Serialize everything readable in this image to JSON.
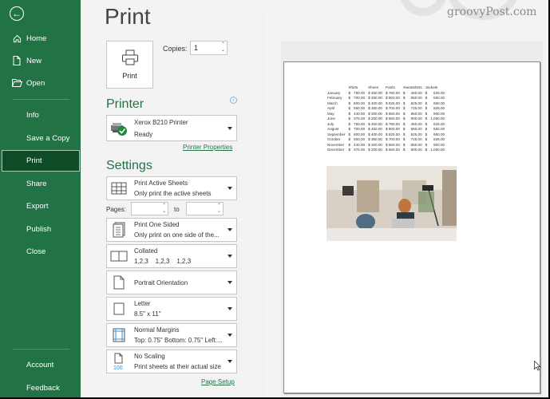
{
  "sidebar": {
    "back_icon": "arrow-left-circle-icon",
    "items": [
      {
        "label": "Home",
        "icon": "home-icon"
      },
      {
        "label": "New",
        "icon": "new-file-icon"
      },
      {
        "label": "Open",
        "icon": "folder-open-icon"
      },
      {
        "label": "Info"
      },
      {
        "label": "Save a Copy"
      },
      {
        "label": "Print",
        "active": true
      },
      {
        "label": "Share"
      },
      {
        "label": "Export"
      },
      {
        "label": "Publish"
      },
      {
        "label": "Close"
      }
    ],
    "footer": [
      {
        "label": "Account"
      },
      {
        "label": "Feedback"
      }
    ],
    "accent_color": "#217346",
    "active_color": "#0e4b26"
  },
  "main": {
    "title": "Print",
    "print_button_label": "Print",
    "copies_label": "Copies:",
    "copies_value": "1",
    "printer_heading": "Printer",
    "printer": {
      "name": "Xerox B210 Printer",
      "status": "Ready"
    },
    "printer_properties_link": "Printer Properties",
    "settings_heading": "Settings",
    "settings": [
      {
        "title": "Print Active Sheets",
        "subtitle": "Only print the active sheets",
        "icon": "sheets-grid-icon"
      },
      {
        "title": "Print One Sided",
        "subtitle": "Only print on one side of the...",
        "icon": "one-sided-page-icon"
      },
      {
        "title": "Collated",
        "subtitle": "1,2,3    1,2,3    1,2,3",
        "icon": "collated-icon"
      },
      {
        "title": "Portrait Orientation",
        "subtitle": "",
        "icon": "portrait-page-icon"
      },
      {
        "title": "Letter",
        "subtitle": "8.5\" x 11\"",
        "icon": "paper-size-icon"
      },
      {
        "title": "Normal Margins",
        "subtitle": "Top: 0.75\" Bottom: 0.75\" Left:...",
        "icon": "margins-icon"
      },
      {
        "title": "No Scaling",
        "subtitle": "Print sheets at their actual size",
        "icon": "scaling-100-icon"
      }
    ],
    "pages_label": "Pages:",
    "pages_from": "",
    "pages_to": "",
    "to_label": "to",
    "page_setup_link": "Page Setup"
  },
  "preview": {
    "headers": [
      "",
      "Shirts",
      "Shoes",
      "Pants",
      "Sweatshirts",
      "Jackets"
    ],
    "rows": [
      [
        "January",
        "750.00",
        "$ 450.00",
        "$ 780.00",
        "450.00",
        "625.00"
      ],
      [
        "February",
        "700.00",
        "$ 450.00",
        "$ 800.00",
        "550.00",
        "550.00"
      ],
      [
        "March",
        "600.00",
        "$ 400.00",
        "$ 825.00",
        "625.00",
        "650.00"
      ],
      [
        "April",
        "550.00",
        "$ 350.00",
        "$ 700.00",
        "725.00",
        "825.00"
      ],
      [
        "May",
        "440.00",
        "$ 300.00",
        "$ 650.00",
        "850.00",
        "900.00"
      ],
      [
        "June",
        "375.00",
        "$ 200.00",
        "$ 650.00",
        "800.00",
        "1,050.00"
      ],
      [
        "July",
        "750.00",
        "$ 450.00",
        "$ 780.00",
        "450.00",
        "625.00"
      ],
      [
        "August",
        "700.00",
        "$ 450.00",
        "$ 800.00",
        "550.00",
        "550.00"
      ],
      [
        "September",
        "600.00",
        "$ 400.00",
        "$ 825.00",
        "625.00",
        "650.00"
      ],
      [
        "October",
        "550.00",
        "$ 350.00",
        "$ 700.00",
        "725.00",
        "825.00"
      ],
      [
        "November",
        "440.00",
        "$ 300.00",
        "$ 650.00",
        "850.00",
        "900.00"
      ],
      [
        "December",
        "375.00",
        "$ 200.00",
        "$ 650.00",
        "800.00",
        "1,050.00"
      ]
    ],
    "image_description": "office-photo"
  },
  "watermark": "groovyPost.com"
}
